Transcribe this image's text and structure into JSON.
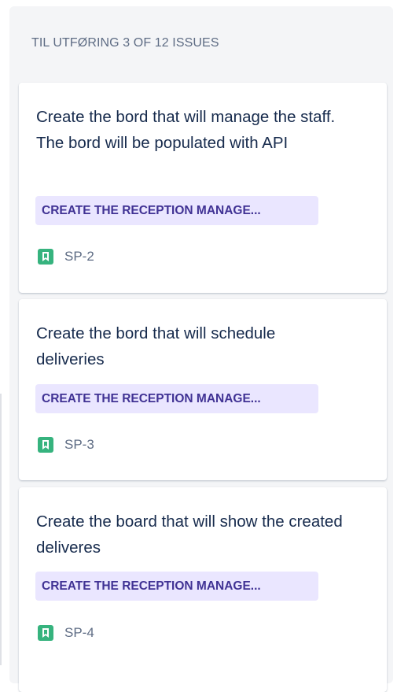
{
  "column": {
    "header": "TIL UTFØRING 3 OF 12 ISSUES"
  },
  "cards": [
    {
      "title": "Create the bord that will manage the staff. The bord will be populated with API",
      "epic": "CREATE THE RECEPTION MANAGE...",
      "issue_type_icon": "story-icon",
      "key": "SP-2"
    },
    {
      "title": "Create the bord that will schedule deliveries",
      "epic": "CREATE THE RECEPTION MANAGE...",
      "issue_type_icon": "story-icon",
      "key": "SP-3"
    },
    {
      "title": "Create the board that will show the created deliveres",
      "epic": "CREATE THE RECEPTION MANAGE...",
      "issue_type_icon": "story-icon",
      "key": "SP-4"
    }
  ],
  "colors": {
    "column_bg": "#f4f5f7",
    "epic_bg": "#eae6ff",
    "epic_text": "#403294",
    "story_icon": "#36b37e",
    "key_text": "#5e6c84"
  }
}
